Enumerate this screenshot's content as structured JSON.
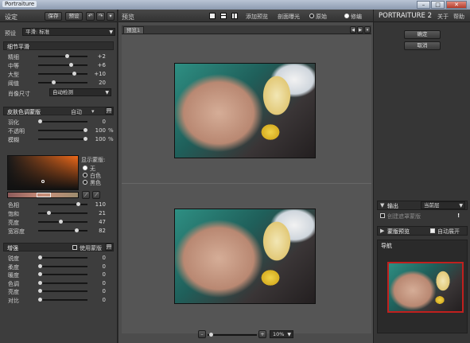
{
  "window": {
    "title": "Portraiture",
    "btn_min": "–",
    "btn_max": "□",
    "btn_close": "✕"
  },
  "left": {
    "header": {
      "title": "设定",
      "save": "保存",
      "preset": "预设",
      "undo": "↶",
      "redo": "↷",
      "menu": "▾"
    },
    "preset": {
      "label": "预设",
      "value": "平滑: 标准"
    },
    "detail": {
      "title": "细节平滑",
      "rows": [
        {
          "label": "精细",
          "value": "+2",
          "pos": 0.6
        },
        {
          "label": "中等",
          "value": "+6",
          "pos": 0.68
        },
        {
          "label": "大型",
          "value": "+10",
          "pos": 0.76
        },
        {
          "label": "阈值",
          "value": "20",
          "pos": 0.3
        }
      ],
      "portrait_size_label": "肖像尺寸",
      "portrait_size_value": "自动检测"
    },
    "skin": {
      "title": "皮肤色调蒙版",
      "mode": "自动",
      "toggle": "开",
      "rows": [
        {
          "label": "羽化",
          "value": "0",
          "pos": 0.0
        },
        {
          "label": "不透明",
          "value": "100",
          "unit": "%",
          "pos": 1.0
        },
        {
          "label": "模糊",
          "value": "100",
          "unit": "%",
          "pos": 1.0
        }
      ],
      "show_mask_label": "显示蒙版:",
      "show_options": [
        "无",
        "白色",
        "黑色"
      ],
      "show_selected": 0,
      "color_rows": [
        {
          "label": "色相",
          "value": "110",
          "pos": 0.85
        },
        {
          "label": "饱和",
          "value": "21",
          "pos": 0.2
        },
        {
          "label": "亮度",
          "value": "47",
          "pos": 0.45
        },
        {
          "label": "宽容度",
          "value": "82",
          "pos": 0.8
        }
      ]
    },
    "enhance": {
      "title": "增强",
      "use_mask_label": "使用蒙版",
      "toggle": "开",
      "rows": [
        {
          "label": "锐度",
          "value": "0"
        },
        {
          "label": "柔度",
          "value": "0"
        },
        {
          "label": "暖度",
          "value": "0"
        },
        {
          "label": "色调",
          "value": "0"
        },
        {
          "label": "亮度",
          "value": "0"
        },
        {
          "label": "对比",
          "value": "0"
        }
      ]
    }
  },
  "center": {
    "header": {
      "title": "预览",
      "add_preset": "添加预览",
      "compare": "剖面曝光",
      "before": "原始",
      "after": "修编"
    },
    "tab": "预览1",
    "zoom": "10%",
    "zoom_minus": "–",
    "zoom_plus": "+"
  },
  "right": {
    "brand": "PORTRAITURE 2",
    "about": "关于",
    "help": "帮助",
    "ok": "确定",
    "cancel": "取消",
    "output": {
      "label": "输出",
      "value": "当前层",
      "create_mask": "创建遮罩蒙版",
      "warn": "!"
    },
    "mask_preview": {
      "label": "蒙版预览",
      "auto_expand": "自动展开"
    },
    "navigator": {
      "label": "导航"
    }
  },
  "colors": {
    "accent": "#c0201e",
    "panel": "#3d3d3d",
    "dark": "#2b2b2b"
  }
}
